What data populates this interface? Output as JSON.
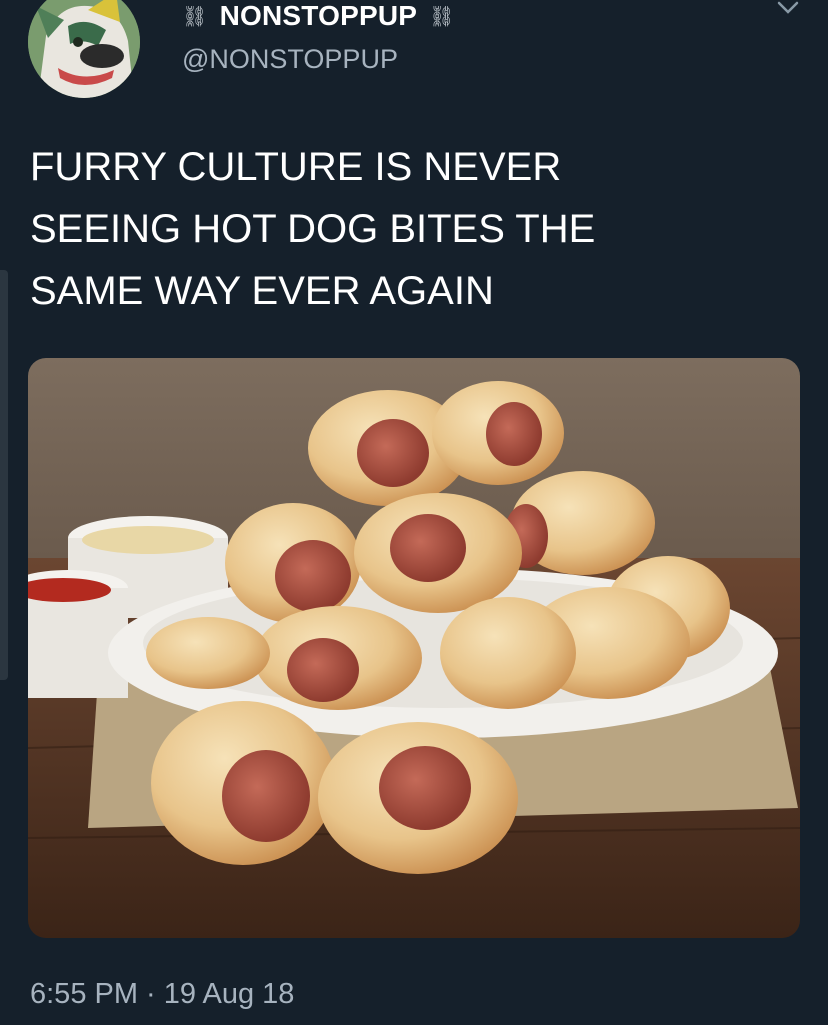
{
  "user": {
    "display_name": "NONSTOPPUP",
    "handle": "@NONSTOPPUP",
    "decoration_icon": "chain-link-icon",
    "avatar_icon": "avatar-wolf-icon"
  },
  "tweet": {
    "lines": [
      "FURRY CULTURE IS NEVER",
      "SEEING HOT DOG BITES THE",
      "SAME WAY EVER AGAIN"
    ],
    "timestamp": "6:55 PM · 19 Aug 18"
  },
  "menu": {
    "icon": "chevron-down-icon"
  },
  "colors": {
    "background": "#15202b",
    "text": "#ffffff",
    "secondary_text": "#a7b3bf"
  }
}
